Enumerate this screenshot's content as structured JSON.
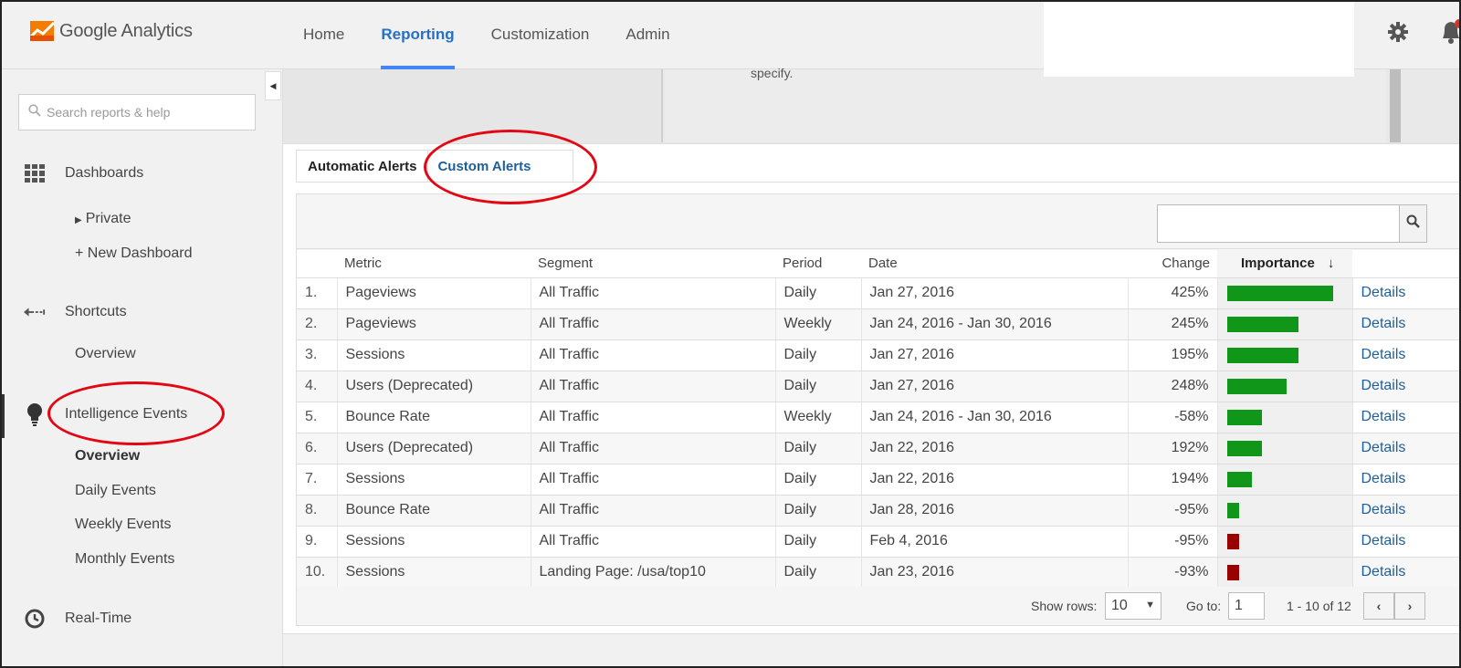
{
  "app": {
    "name": "Google Analytics"
  },
  "topnav": {
    "items": [
      {
        "label": "Home",
        "active": false
      },
      {
        "label": "Reporting",
        "active": true
      },
      {
        "label": "Customization",
        "active": false
      },
      {
        "label": "Admin",
        "active": false
      }
    ],
    "icons": [
      "gear-icon",
      "bell-icon"
    ]
  },
  "sidebar": {
    "search_placeholder": "Search reports & help",
    "dashboards": {
      "label": "Dashboards",
      "icon": "grid-icon",
      "items": [
        "Private",
        "+ New Dashboard"
      ]
    },
    "shortcuts": {
      "label": "Shortcuts",
      "icon": "shortcut-arrow-icon",
      "items": [
        "Overview"
      ]
    },
    "intelligence": {
      "label": "Intelligence Events",
      "icon": "lightbulb-icon",
      "items": [
        "Overview",
        "Daily Events",
        "Weekly Events",
        "Monthly Events"
      ]
    },
    "realtime": {
      "label": "Real-Time",
      "icon": "clock-icon"
    }
  },
  "upper_panel": {
    "text": "specify."
  },
  "tabs": [
    {
      "label": "Automatic Alerts",
      "active": true
    },
    {
      "label": "Custom Alerts",
      "active": false
    }
  ],
  "table": {
    "columns": [
      "Metric",
      "Segment",
      "Period",
      "Date",
      "Change",
      "Importance"
    ],
    "sort_icon": "arrow-down-icon",
    "rows": [
      {
        "idx": "1.",
        "metric": "Pageviews",
        "segment": "All Traffic",
        "period": "Daily",
        "date": "Jan 27, 2016",
        "change": "425%",
        "importance": 1.0,
        "color": "#109618",
        "details": "Details"
      },
      {
        "idx": "2.",
        "metric": "Pageviews",
        "segment": "All Traffic",
        "period": "Weekly",
        "date": "Jan 24, 2016 - Jan 30, 2016",
        "change": "245%",
        "importance": 0.67,
        "color": "#109618",
        "details": "Details"
      },
      {
        "idx": "3.",
        "metric": "Sessions",
        "segment": "All Traffic",
        "period": "Daily",
        "date": "Jan 27, 2016",
        "change": "195%",
        "importance": 0.67,
        "color": "#109618",
        "details": "Details"
      },
      {
        "idx": "4.",
        "metric": "Users (Deprecated)",
        "segment": "All Traffic",
        "period": "Daily",
        "date": "Jan 27, 2016",
        "change": "248%",
        "importance": 0.56,
        "color": "#109618",
        "details": "Details"
      },
      {
        "idx": "5.",
        "metric": "Bounce Rate",
        "segment": "All Traffic",
        "period": "Weekly",
        "date": "Jan 24, 2016 - Jan 30, 2016",
        "change": "-58%",
        "importance": 0.33,
        "color": "#109618",
        "details": "Details"
      },
      {
        "idx": "6.",
        "metric": "Users (Deprecated)",
        "segment": "All Traffic",
        "period": "Daily",
        "date": "Jan 22, 2016",
        "change": "192%",
        "importance": 0.33,
        "color": "#109618",
        "details": "Details"
      },
      {
        "idx": "7.",
        "metric": "Sessions",
        "segment": "All Traffic",
        "period": "Daily",
        "date": "Jan 22, 2016",
        "change": "194%",
        "importance": 0.23,
        "color": "#109618",
        "details": "Details"
      },
      {
        "idx": "8.",
        "metric": "Bounce Rate",
        "segment": "All Traffic",
        "period": "Daily",
        "date": "Jan 28, 2016",
        "change": "-95%",
        "importance": 0.11,
        "color": "#109618",
        "details": "Details"
      },
      {
        "idx": "9.",
        "metric": "Sessions",
        "segment": "All Traffic",
        "period": "Daily",
        "date": "Feb 4, 2016",
        "change": "-95%",
        "importance": 0.11,
        "color": "#990000",
        "details": "Details"
      },
      {
        "idx": "10.",
        "metric": "Sessions",
        "segment": "Landing Page: /usa/top10",
        "period": "Daily",
        "date": "Jan 23, 2016",
        "change": "-93%",
        "importance": 0.11,
        "color": "#990000",
        "details": "Details"
      }
    ]
  },
  "pager": {
    "show_rows_label": "Show rows:",
    "show_rows_value": "10",
    "goto_label": "Go to:",
    "goto_value": "1",
    "range": "1 - 10 of 12",
    "prev": "‹",
    "next": "›"
  }
}
